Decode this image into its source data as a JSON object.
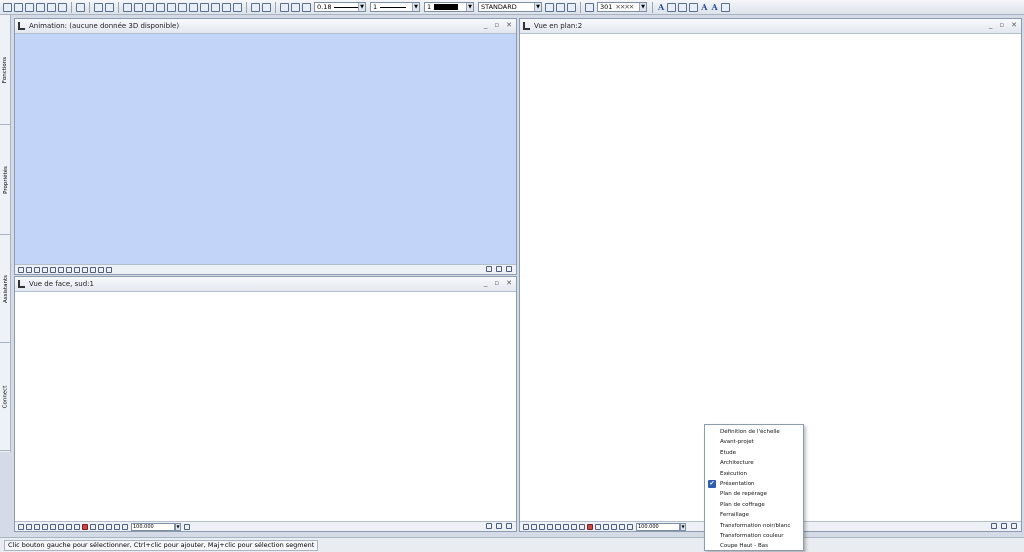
{
  "toolbar": {
    "pen_thickness": "0.18",
    "line_type": "1",
    "color_index": "1",
    "layer": "STANDARD",
    "hatch_number": "301"
  },
  "sidebar": {
    "tabs": [
      "Fonctions",
      "Propriétés",
      "Assistants",
      "Connect"
    ]
  },
  "panes": {
    "animation": {
      "title": "Animation: (aucune donnée 3D disponible)",
      "bg": "#c3d4f9"
    },
    "front": {
      "title": "Vue de face, sud:1",
      "scale": "100.000"
    },
    "plan": {
      "title": "Vue en plan:2",
      "scale": "100.000"
    }
  },
  "statusbar": {
    "message": "Clic bouton gauche pour sélectionner, Ctrl+clic pour ajouter, Maj+clic pour sélection segment"
  },
  "context_menu": {
    "items": [
      {
        "label": "Définition de l'échelle",
        "checked": false
      },
      {
        "label": "Avant-projet",
        "checked": false
      },
      {
        "label": "Etude",
        "checked": false
      },
      {
        "label": "Architecture",
        "checked": false
      },
      {
        "label": "Exécution",
        "checked": false
      },
      {
        "label": "Présentation",
        "checked": true
      },
      {
        "label": "Plan de repérage",
        "checked": false
      },
      {
        "label": "Plan de coffrage",
        "checked": false
      },
      {
        "label": "Ferraillage",
        "checked": false
      },
      {
        "label": "Transformation noir/blanc",
        "checked": false
      },
      {
        "label": "Transformation couleur",
        "checked": false
      },
      {
        "label": "Coupe Haut - Bas",
        "checked": false
      }
    ]
  }
}
